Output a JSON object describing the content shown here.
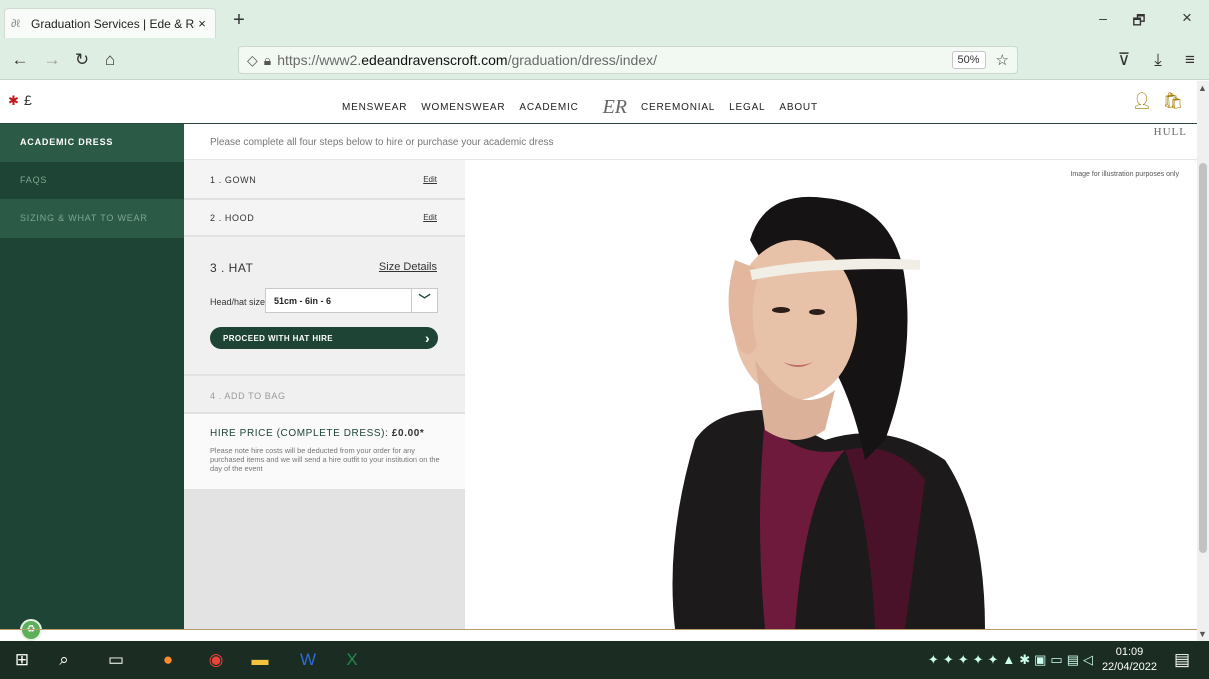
{
  "browser": {
    "tab_title": "Graduation Services | Ede & Rav",
    "tab_close": "×",
    "new_tab": "+",
    "url_prefix": "https://www2.",
    "url_domain": "edeandravenscroft.com",
    "url_path": "/graduation/dress/index/",
    "zoom": "50%",
    "win_min": "–",
    "win_max": "🗗",
    "win_close": "×"
  },
  "site": {
    "currency": "£",
    "menu": [
      "MENSWEAR",
      "WOMENSWEAR",
      "ACADEMIC",
      "CEREMONIAL",
      "LEGAL",
      "ABOUT"
    ],
    "logo": "ER",
    "institution": "HULL"
  },
  "sidebar": {
    "items": [
      {
        "label": "ACADEMIC DRESS"
      },
      {
        "label": "FAQS"
      },
      {
        "label": "SIZING & WHAT TO WEAR"
      }
    ]
  },
  "main": {
    "intro": "Please complete all four steps below to hire or purchase your academic dress",
    "illustration_note": "Image for illustration purposes only",
    "steps": {
      "gown": {
        "label": "1 . GOWN",
        "edit": "Edit"
      },
      "hood": {
        "label": "2 . HOOD",
        "edit": "Edit"
      },
      "hat": {
        "label": "3 . HAT",
        "size_details": "Size Details",
        "size_label": "Head/hat size",
        "size_value": "51cm - 6in - 6",
        "proceed": "PROCEED WITH HAT HIRE"
      },
      "bag": {
        "label": "4 . ADD TO BAG"
      }
    },
    "price": {
      "heading": "HIRE PRICE (COMPLETE DRESS): ",
      "amount": "£0.00*",
      "note": "Please note hire costs will be deducted from your order for any purchased items and we will send a hire outfit to your institution on the day of the event"
    }
  },
  "taskbar": {
    "time": "01:09",
    "date": "22/04/2022"
  }
}
